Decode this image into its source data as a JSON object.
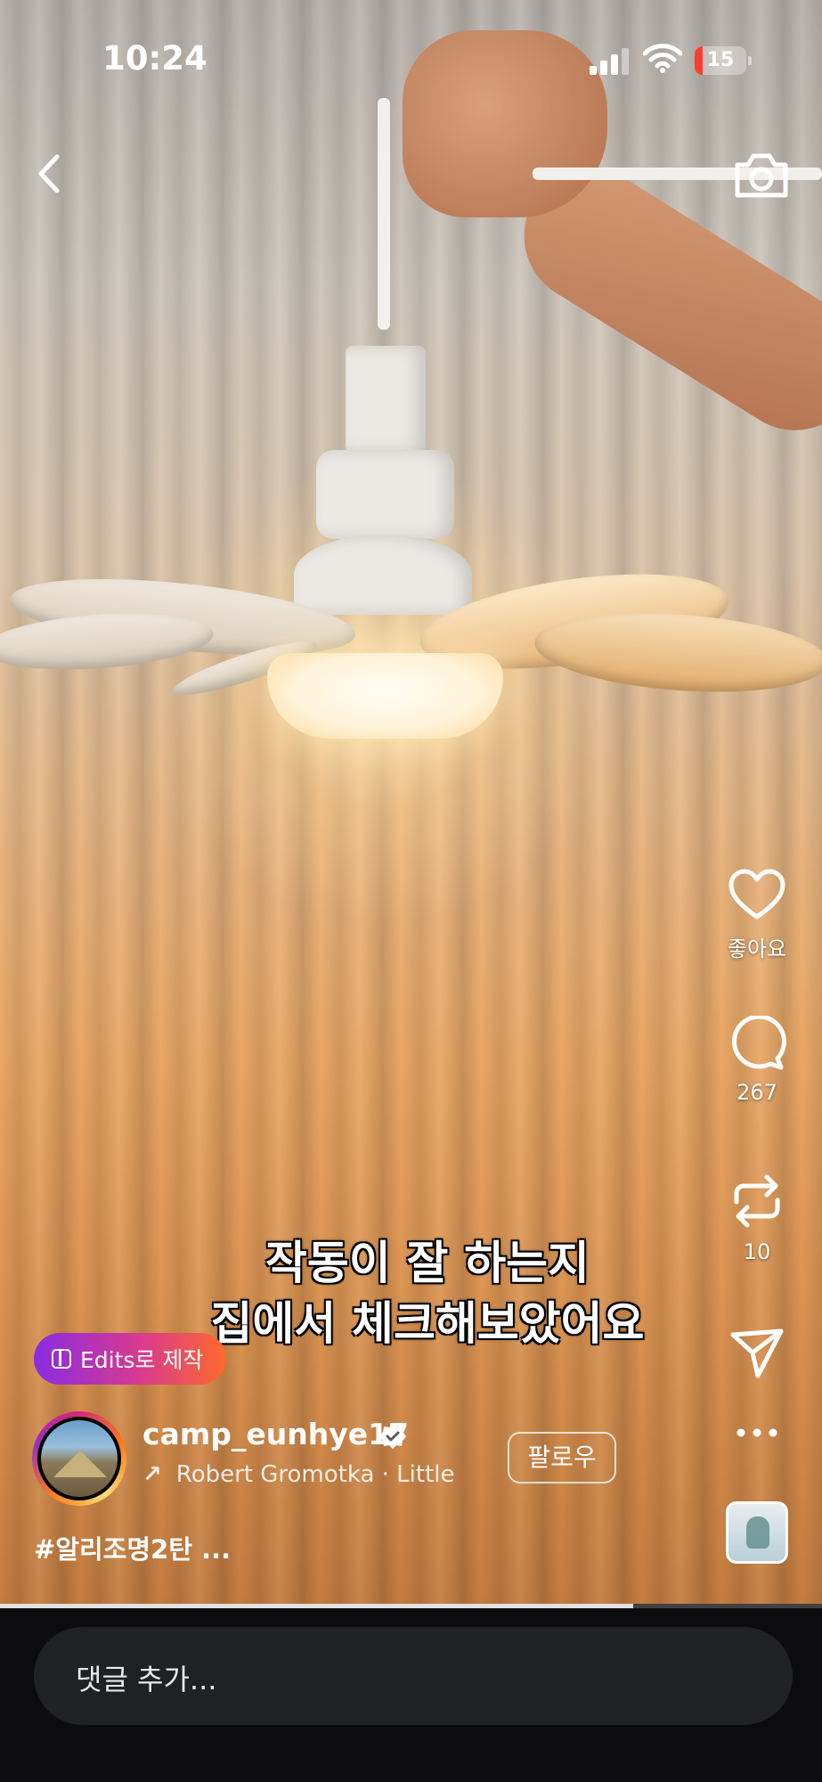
{
  "status_bar": {
    "time": "10:24",
    "battery": "15"
  },
  "caption": {
    "line1": "작동이 잘 하는지",
    "line2": "집에서 체크해보았어요"
  },
  "edits_button": {
    "label": "Edits로 제작"
  },
  "author": {
    "username": "camp_eunhye17",
    "follow_label": "팔로우"
  },
  "music": {
    "text": "Robert Gromotka · Little"
  },
  "post": {
    "hashtag_text": "#알리조명2탄 ..."
  },
  "actions": {
    "like_label": "좋아요",
    "comment_count": "267",
    "repost_count": "10"
  },
  "comment_input": {
    "placeholder": "댓글 추가..."
  },
  "video": {
    "progress": 0.77
  },
  "colors": {
    "edits_gradient": [
      "#8a2be2",
      "#d83a8e",
      "#ff6a2b"
    ],
    "battery_low": "#ff3b30",
    "bottom_bar": "#0c0c0e"
  },
  "icons": [
    "back-icon",
    "camera-icon",
    "heart-icon",
    "comment-icon",
    "repost-icon",
    "send-icon",
    "more-icon",
    "verified-icon",
    "music-arrow-icon"
  ]
}
